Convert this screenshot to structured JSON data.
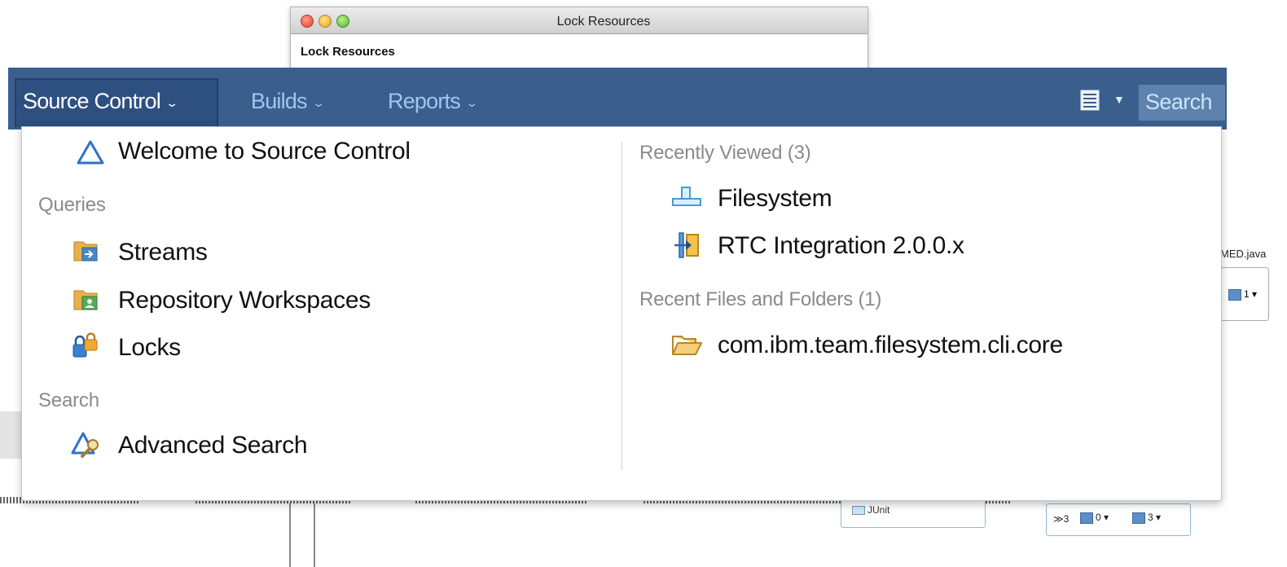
{
  "dialog": {
    "title": "Lock Resources",
    "subtitle": "Lock Resources"
  },
  "navbar": {
    "tabs": [
      {
        "label": "Source Control",
        "active": true
      },
      {
        "label": "Builds",
        "active": false
      },
      {
        "label": "Reports",
        "active": false
      }
    ],
    "search_label": "Search",
    "colors": {
      "bar": "#3b5f8c",
      "active_tab": "#2d5080",
      "tab_text": "#9fc6ef"
    }
  },
  "dropdown": {
    "welcome": {
      "label": "Welcome to Source Control",
      "icon": "source-control-triangle-icon"
    },
    "queries": {
      "heading": "Queries",
      "items": [
        {
          "label": "Streams",
          "icon": "streams-folder-icon"
        },
        {
          "label": "Repository Workspaces",
          "icon": "repository-workspaces-folder-icon"
        },
        {
          "label": "Locks",
          "icon": "lock-icon"
        }
      ]
    },
    "search": {
      "heading": "Search",
      "items": [
        {
          "label": "Advanced Search",
          "icon": "advanced-search-icon"
        }
      ]
    },
    "recently_viewed": {
      "heading": "Recently Viewed (3)",
      "items": [
        {
          "label": "Filesystem",
          "icon": "component-icon"
        },
        {
          "label": "RTC Integration 2.0.0.x",
          "icon": "stream-icon"
        }
      ]
    },
    "recent_files": {
      "heading": "Recent Files and Folders (1)",
      "items": [
        {
          "label": "com.ibm.team.filesystem.cli.core",
          "icon": "open-folder-icon"
        }
      ]
    }
  },
  "background": {
    "junit_label": "JUnit",
    "right_file_label": "MED.java",
    "count_left": "3",
    "count_mid": "0",
    "count_right": "3",
    "right_count": "1"
  }
}
